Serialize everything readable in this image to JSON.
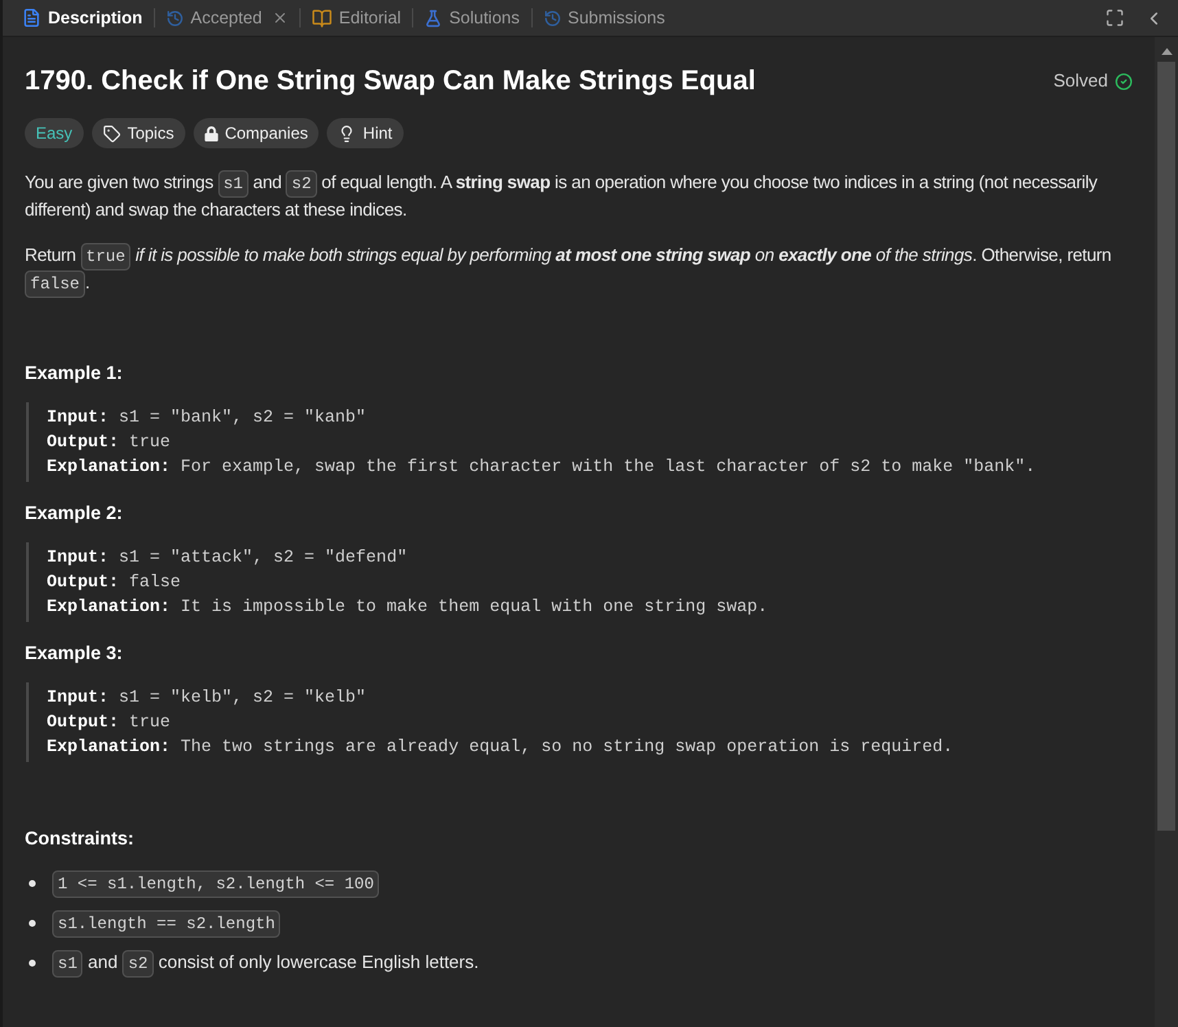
{
  "tabs": [
    {
      "label": "Description",
      "kind": "document",
      "selected": true,
      "closable": false
    },
    {
      "label": "Accepted",
      "kind": "history",
      "selected": false,
      "closable": true
    },
    {
      "label": "Editorial",
      "kind": "book",
      "selected": false,
      "closable": false
    },
    {
      "label": "Solutions",
      "kind": "flask",
      "selected": false,
      "closable": false
    },
    {
      "label": "Submissions",
      "kind": "history",
      "selected": false,
      "closable": false
    }
  ],
  "problem": {
    "title": "1790. Check if One String Swap Can Make Strings Equal",
    "status": "Solved",
    "difficulty": "Easy",
    "tags": [
      {
        "label": "Topics",
        "kind": "tag"
      },
      {
        "label": "Companies",
        "kind": "lock"
      },
      {
        "label": "Hint",
        "kind": "bulb"
      }
    ]
  },
  "description": [
    [
      {
        "kind": "text",
        "text": "You are given two strings "
      },
      {
        "kind": "code",
        "text": "s1"
      },
      {
        "kind": "text",
        "text": " and "
      },
      {
        "kind": "code",
        "text": "s2"
      },
      {
        "kind": "text",
        "text": " of equal length. A **string swap** is an operation where you choose two indices in a string (not necessarily different) and swap the characters at these indices."
      }
    ],
    [
      {
        "kind": "text",
        "text": "Return "
      },
      {
        "kind": "code",
        "text": "true"
      },
      {
        "kind": "italic",
        "text": " if it is possible to make both strings equal by performing **at most one string swap** on **exactly one** of the strings"
      },
      {
        "kind": "text",
        "text": ". Otherwise, return "
      },
      {
        "kind": "code",
        "text": "false"
      },
      {
        "kind": "text",
        "text": "."
      }
    ]
  ],
  "examples": [
    {
      "title": "Example 1:",
      "lines": [
        {
          "label": "Input:",
          "value": "s1 = \"bank\", s2 = \"kanb\""
        },
        {
          "label": "Output:",
          "value": "true"
        },
        {
          "label": "Explanation:",
          "value": "For example, swap the first character with the last character of s2 to make \"bank\"."
        }
      ]
    },
    {
      "title": "Example 2:",
      "lines": [
        {
          "label": "Input:",
          "value": "s1 = \"attack\", s2 = \"defend\""
        },
        {
          "label": "Output:",
          "value": "false"
        },
        {
          "label": "Explanation:",
          "value": "It is impossible to make them equal with one string swap."
        }
      ]
    },
    {
      "title": "Example 3:",
      "lines": [
        {
          "label": "Input:",
          "value": "s1 = \"kelb\", s2 = \"kelb\""
        },
        {
          "label": "Output:",
          "value": "true"
        },
        {
          "label": "Explanation:",
          "value": "The two strings are already equal, so no string swap operation is required."
        }
      ]
    }
  ],
  "constraints": {
    "title": "Constraints:",
    "items": [
      [
        {
          "kind": "code",
          "text": "1 <= s1.length, s2.length <= 100"
        }
      ],
      [
        {
          "kind": "code",
          "text": "s1.length == s2.length"
        }
      ],
      [
        {
          "kind": "code",
          "text": "s1"
        },
        {
          "kind": "text",
          "text": " and "
        },
        {
          "kind": "code",
          "text": "s2"
        },
        {
          "kind": "text",
          "text": " consist of only lowercase English letters."
        }
      ]
    ]
  }
}
